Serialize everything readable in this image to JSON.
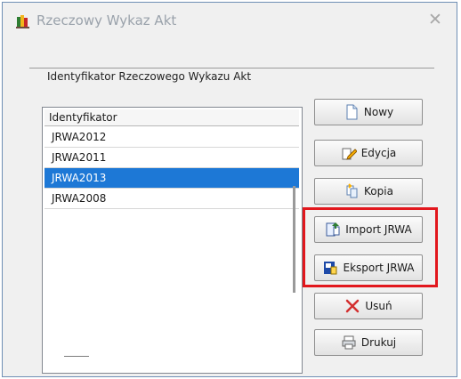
{
  "window": {
    "title": "Rzeczowy Wykaz Akt",
    "icon": "books-icon"
  },
  "group": {
    "label": "Identyfikator Rzeczowego Wykazu Akt"
  },
  "list": {
    "header": "Identyfikator",
    "rows": [
      "JRWA2012",
      "JRWA2011",
      "JRWA2013",
      "JRWA2008"
    ],
    "selected_index": 2
  },
  "buttons": {
    "nowy": "Nowy",
    "edycja": "Edycja",
    "kopia": "Kopia",
    "import": "Import JRWA",
    "eksport": "Eksport JRWA",
    "usun": "Usuń",
    "drukuj": "Drukuj"
  },
  "colors": {
    "selection": "#1d78d6",
    "highlight": "#e2171d"
  }
}
